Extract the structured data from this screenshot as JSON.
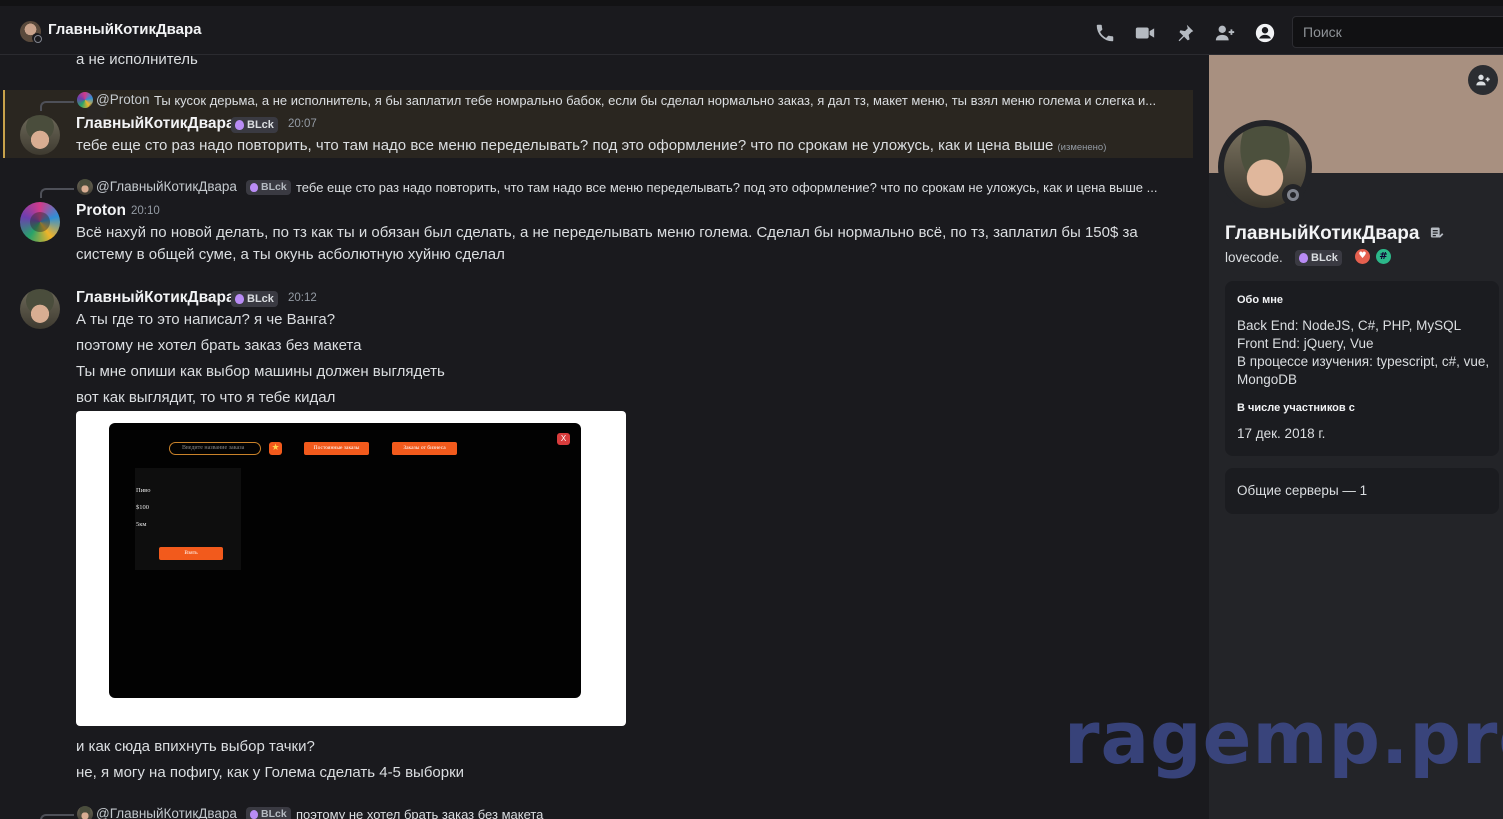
{
  "header": {
    "channel_title": "ГлавныйКотикДвара",
    "search_placeholder": "Поиск",
    "icons": [
      "phone-icon",
      "video-icon",
      "pin-icon",
      "add-member-icon",
      "profile-icon"
    ]
  },
  "messages": {
    "top_fragment": "а не исполнитель",
    "m1": {
      "reply_name": "@Proton",
      "reply_text": "Ты кусок дерьма, а не исполнитель, я бы заплатил тебе номрально бабок, если бы сделал нормально заказ, я дал тз, макет меню, ты взял меню голема и слегка и...",
      "author": "ГлавныйКотикДвара",
      "tag": "BLck",
      "time": "20:07",
      "text": "тебе еще сто раз надо повторить, что там надо все меню переделывать? под это оформление? что по срокам не уложусь, как и цена выше",
      "edited": "(изменено)"
    },
    "m2": {
      "reply_name": "@ГлавныйКотикДвара",
      "reply_tag": "BLck",
      "reply_text": "тебе еще сто раз надо повторить, что там надо все меню переделывать? под это оформление? что по срокам не уложусь, как и цена выше ...",
      "author": "Proton",
      "time": "20:10",
      "line1": "Всё нахуй по новой делать, по тз как ты и обязан был сделать, а не переделывать меню голема. Сделал бы нормально всё, по тз, заплатил бы 150$ за",
      "line2": "систему в общей суме, а ты окунь асболютную хуйню сделал"
    },
    "m3": {
      "author": "ГлавныйКотикДвара",
      "tag": "BLck",
      "time": "20:12",
      "line1": "А ты где то это написал? я че Ванга?",
      "line2": "поэтому не хотел брать заказ без макета",
      "line3": "Ты мне опиши как выбор машины должен выглядеть",
      "line4": "вот как выглядит, то что я тебе кидал",
      "after1": "и как сюда впихнуть выбор тачки?",
      "after2": "не, я могу на пофигу, как у Голема сделать 4-5 выборки"
    },
    "m4": {
      "reply_name": "@ГлавныйКотикДвара",
      "reply_tag": "BLck",
      "reply_text": "поэтому не хотел брать заказ без макета"
    }
  },
  "embed": {
    "search_placeholder": "Введите название заказа",
    "btn1": "Постоянные заказы",
    "btn2": "Заказы от бизнеса",
    "close": "X",
    "item_name": "Пиво",
    "item_price": "$100",
    "item_dist": "5км",
    "take": "Взять"
  },
  "profile": {
    "name": "ГлавныйКотикДвара",
    "username": "lovecode.",
    "tag": "BLck",
    "about_heading": "Обо мне",
    "about_1": "Back End: NodeJS, C#, PHP, MySQL",
    "about_2": "Front End: jQuery, Vue",
    "about_3": "В процессе изучения: typescript, c#, vue,",
    "about_4": "MongoDB",
    "member_heading": "В числе участников с",
    "member_since": "17 дек. 2018 г.",
    "servers": "Общие серверы — 1"
  },
  "watermark": "ragemp.pro",
  "colors": {
    "accent_orange": "#f25a1c",
    "highlight_border": "#c8a24b",
    "banner": "#a89080"
  }
}
